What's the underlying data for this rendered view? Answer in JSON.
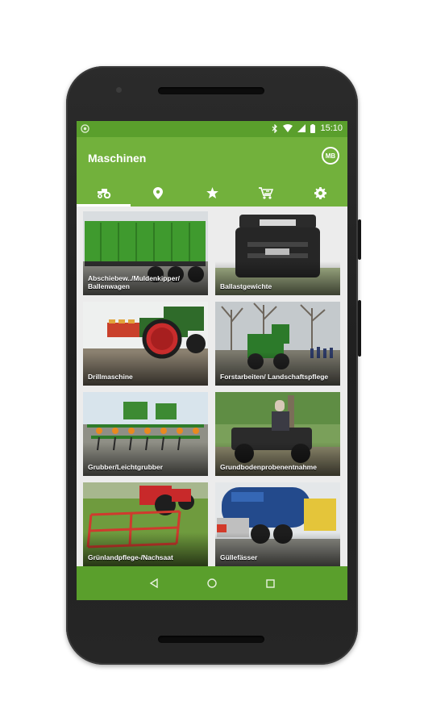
{
  "status": {
    "time": "15:10"
  },
  "app": {
    "title": "Maschinen",
    "profile_initials": "MB"
  },
  "tabs": [
    {
      "icon": "tractor-icon",
      "active": true
    },
    {
      "icon": "location-pin-icon",
      "active": false
    },
    {
      "icon": "star-icon",
      "active": false
    },
    {
      "icon": "cart-icon",
      "active": false
    },
    {
      "icon": "gear-icon",
      "active": false
    }
  ],
  "categories": [
    {
      "label": "Abschiebew../Muldenkipper/ Ballenwagen"
    },
    {
      "label": "Ballastgewichte"
    },
    {
      "label": "Drillmaschine"
    },
    {
      "label": "Forstarbeiten/ Landschaftspflege"
    },
    {
      "label": "Grubber/Leichtgrubber"
    },
    {
      "label": "Grundbodenprobenentnahme"
    },
    {
      "label": "Grünlandpflege-/Nachsaat"
    },
    {
      "label": "Güllefässer"
    }
  ],
  "colors": {
    "primary": "#72b13c",
    "primary_dark": "#5a9f2c"
  }
}
